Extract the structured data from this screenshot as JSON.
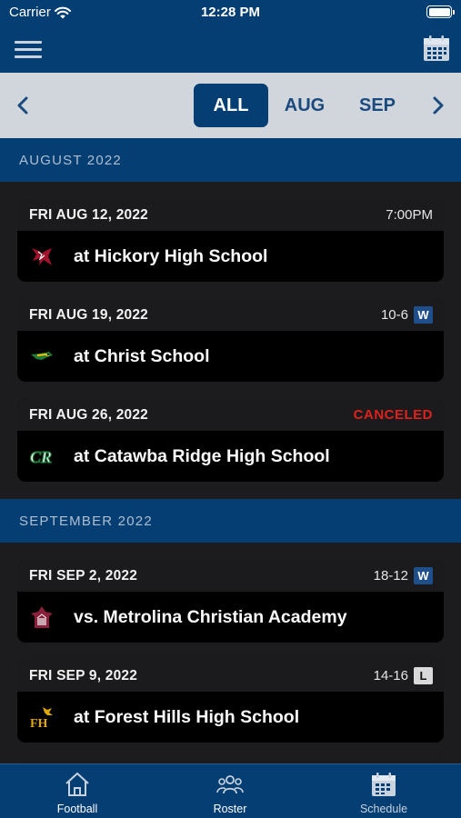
{
  "status_bar": {
    "carrier": "Carrier",
    "time": "12:28 PM"
  },
  "filter": {
    "tabs": [
      "ALL",
      "AUG",
      "SEP"
    ],
    "selected": "ALL"
  },
  "sections": [
    {
      "header": "AUGUST 2022",
      "games": [
        {
          "date": "FRI AUG 12, 2022",
          "status": "7:00PM",
          "opponent": "at Hickory High School",
          "logo_icon": "hickory-logo-icon"
        },
        {
          "date": "FRI AUG 19, 2022",
          "status": "10-6",
          "result": "W",
          "opponent": "at Christ School",
          "logo_icon": "christ-school-logo-icon"
        },
        {
          "date": "FRI AUG 26, 2022",
          "status": "CANCELED",
          "opponent": "at Catawba Ridge High School",
          "logo_icon": "catawba-ridge-logo-icon"
        }
      ]
    },
    {
      "header": "SEPTEMBER 2022",
      "games": [
        {
          "date": "FRI SEP 2, 2022",
          "status": "18-12",
          "result": "W",
          "opponent": "vs. Metrolina Christian Academy",
          "logo_icon": "metrolina-logo-icon"
        },
        {
          "date": "FRI SEP 9, 2022",
          "status": "14-16",
          "result": "L",
          "opponent": "at Forest Hills High School",
          "logo_icon": "forest-hills-logo-icon"
        }
      ]
    }
  ],
  "tab_bar": {
    "items": [
      {
        "label": "Football",
        "icon": "house-icon"
      },
      {
        "label": "Roster",
        "icon": "people-icon"
      },
      {
        "label": "Schedule",
        "icon": "calendar-icon"
      }
    ],
    "selected": "Schedule"
  },
  "colors": {
    "brand": "#053e73",
    "background": "#1c1c1e",
    "filter_bar": "#d1d5dc",
    "canceled": "#e0201c",
    "win_badge": "#1f4f8a",
    "loss_badge": "#d9d9d9"
  }
}
